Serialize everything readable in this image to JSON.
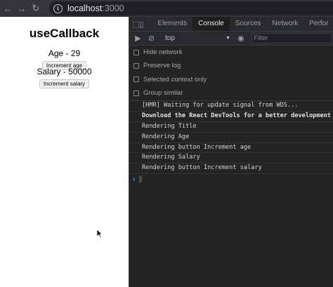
{
  "browser": {
    "url_host": "localhost",
    "url_port": ":3000"
  },
  "page": {
    "title": "useCallback",
    "age_text": "Age - 29",
    "age_button": "Increment age",
    "salary_text": "Salary - 50000",
    "salary_button": "Increment salary"
  },
  "devtools": {
    "tabs": [
      "Elements",
      "Console",
      "Sources",
      "Network",
      "Perfor"
    ],
    "active_tab": "Console",
    "context": "top",
    "filter_placeholder": "Filter",
    "settings": [
      "Hide network",
      "Preserve log",
      "Selected context only",
      "Group similar"
    ],
    "messages": [
      {
        "text": "[HMR] Waiting for update signal from WDS...",
        "bold": false
      },
      {
        "text": "Download the React DevTools for a better development exp",
        "bold": true
      },
      {
        "text": "Rendering Title",
        "bold": false
      },
      {
        "text": "Rendering Age",
        "bold": false
      },
      {
        "text": "Rendering button Increment age",
        "bold": false
      },
      {
        "text": "Rendering Salary",
        "bold": false
      },
      {
        "text": "Rendering button Increment salary",
        "bold": false
      }
    ],
    "prompt_symbol": "›"
  },
  "icons": {
    "back": "back-arrow-icon",
    "forward": "forward-arrow-icon",
    "reload": "reload-icon",
    "info": "info-icon",
    "inspect": "inspect-element-icon",
    "device": "device-toolbar-icon",
    "sidebar": "console-sidebar-icon",
    "clear": "clear-console-icon",
    "eye": "eye-icon",
    "cursor": "mouse-cursor-icon"
  },
  "colors": {
    "accent": "#4a9eff",
    "devtools_bg": "#242424",
    "toolbar_bg": "#35363a"
  }
}
